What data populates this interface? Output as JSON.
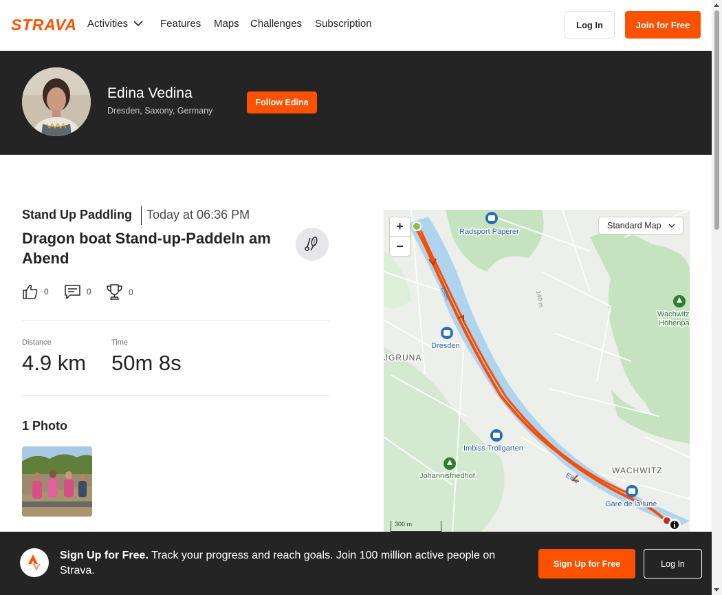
{
  "nav": {
    "logo_text": "STRAVA",
    "items": [
      "Activities",
      "Features",
      "Maps",
      "Challenges",
      "Subscription"
    ],
    "login_label": "Log In",
    "join_label": "Join for Free"
  },
  "athlete": {
    "name": "Edina Vedina",
    "location": "Dresden, Saxony, Germany",
    "follow_label": "Follow Edina"
  },
  "activity": {
    "type": "Stand Up Paddling",
    "time": "Today at 06:36 PM",
    "title": "Dragon boat Stand-up-Paddeln am Abend",
    "kudos_count": "0",
    "comments_count": "0",
    "achievements_count": "0",
    "stats": [
      {
        "label": "Distance",
        "value": "4.9 km"
      },
      {
        "label": "Time",
        "value": "50m 8s"
      }
    ],
    "photos_heading": "1 Photo"
  },
  "map": {
    "style_label": "Standard Map",
    "zoom_in": "+",
    "zoom_out": "−",
    "scale_label": "300 m",
    "labels": {
      "radsport": "Radsport Päperer",
      "dresden": "Dresden",
      "gruna": "JGRUNA",
      "imbiss": "Imbiss Trollgarten",
      "johannis": "Johannisfriedhof",
      "wachwitz": "WACHWITZ",
      "gare": "Gare de la lune",
      "wachwitz_hoehen": "Wachwitz",
      "hoehenpark": "Höhenpa",
      "elbe1": "Elbe",
      "elbe2": "Elbe",
      "contour": "140 m"
    }
  },
  "banner": {
    "headline": "Sign Up for Free.",
    "text": "Track your progress and reach goals. Join 100 million active people on Strava.",
    "signup_label": "Sign Up for Free",
    "login_label": "Log In"
  },
  "colors": {
    "brand": "#fc5200",
    "dark": "#242424",
    "route": "#fc4c02",
    "river": "#aed4f0"
  }
}
